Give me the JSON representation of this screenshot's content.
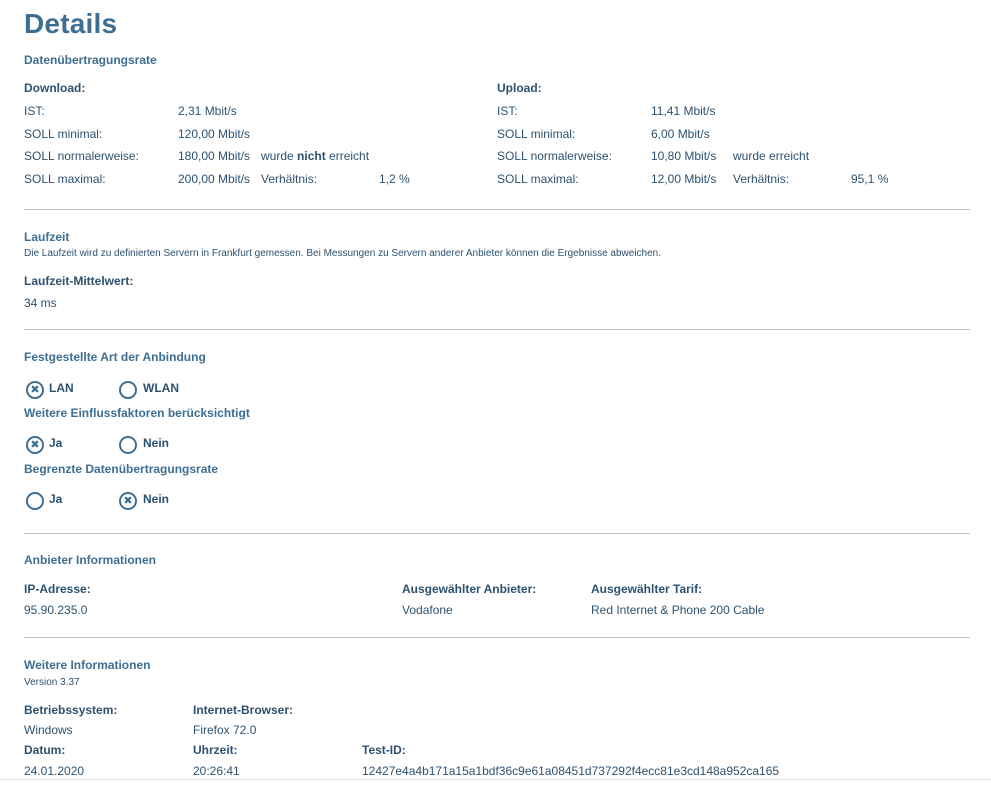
{
  "page": {
    "title": "Details"
  },
  "rate": {
    "heading": "Datenübertragungsrate",
    "download": {
      "heading": "Download:",
      "ist_label": "IST:",
      "ist_value": "2,31 Mbit/s",
      "min_label": "SOLL minimal:",
      "min_value": "120,00 Mbit/s",
      "normal_label": "SOLL normalerweise:",
      "normal_value": "180,00 Mbit/s",
      "normal_note_pre": "wurde ",
      "normal_note_bold": "nicht",
      "normal_note_post": " erreicht",
      "max_label": "SOLL maximal:",
      "max_value": "200,00 Mbit/s",
      "ratio_label": "Verhältnis:",
      "ratio_value": "1,2 %"
    },
    "upload": {
      "heading": "Upload:",
      "ist_label": "IST:",
      "ist_value": "11,41 Mbit/s",
      "min_label": "SOLL minimal:",
      "min_value": "6,00 Mbit/s",
      "normal_label": "SOLL normalerweise:",
      "normal_value": "10,80 Mbit/s",
      "normal_note": "wurde erreicht",
      "max_label": "SOLL maximal:",
      "max_value": "12,00 Mbit/s",
      "ratio_label": "Verhältnis:",
      "ratio_value": "95,1 %"
    }
  },
  "latency": {
    "heading": "Laufzeit",
    "description": "Die Laufzeit wird zu definierten Servern in Frankfurt gemessen. Bei Messungen zu Servern anderer Anbieter können die Ergebnisse abweichen.",
    "mean_label": "Laufzeit-Mittelwert:",
    "mean_value": "34 ms"
  },
  "connection": {
    "heading": "Festgestellte Art der Anbindung",
    "options": [
      {
        "label": "LAN",
        "selected": true
      },
      {
        "label": "WLAN",
        "selected": false
      }
    ],
    "factors_heading": "Weitere Einflussfaktoren berücksichtigt",
    "factors_options": [
      {
        "label": "Ja",
        "selected": true
      },
      {
        "label": "Nein",
        "selected": false
      }
    ],
    "limited_heading": "Begrenzte Datenübertragungsrate",
    "limited_options": [
      {
        "label": "Ja",
        "selected": false
      },
      {
        "label": "Nein",
        "selected": true
      }
    ]
  },
  "provider": {
    "heading": "Anbieter Informationen",
    "ip_label": "IP-Adresse:",
    "ip_value": "95.90.235.0",
    "provider_label": "Ausgewählter Anbieter:",
    "provider_value": "Vodafone",
    "tariff_label": "Ausgewählter Tarif:",
    "tariff_value": "Red Internet & Phone 200 Cable"
  },
  "more": {
    "heading": "Weitere Informationen",
    "version": "Version 3.37",
    "os_label": "Betriebssystem:",
    "os_value": "Windows",
    "browser_label": "Internet-Browser:",
    "browser_value": "Firefox 72.0",
    "date_label": "Datum:",
    "date_value": "24.01.2020",
    "time_label": "Uhrzeit:",
    "time_value": "20:26:41",
    "testid_label": "Test-ID:",
    "testid_value": "12427e4a4b171a15a1bdf36c9e61a08451d737292f4ecc81e3cd148a952ca165"
  },
  "icons": {
    "selected_mark": "✖",
    "accent_color": "#3e6e92"
  }
}
